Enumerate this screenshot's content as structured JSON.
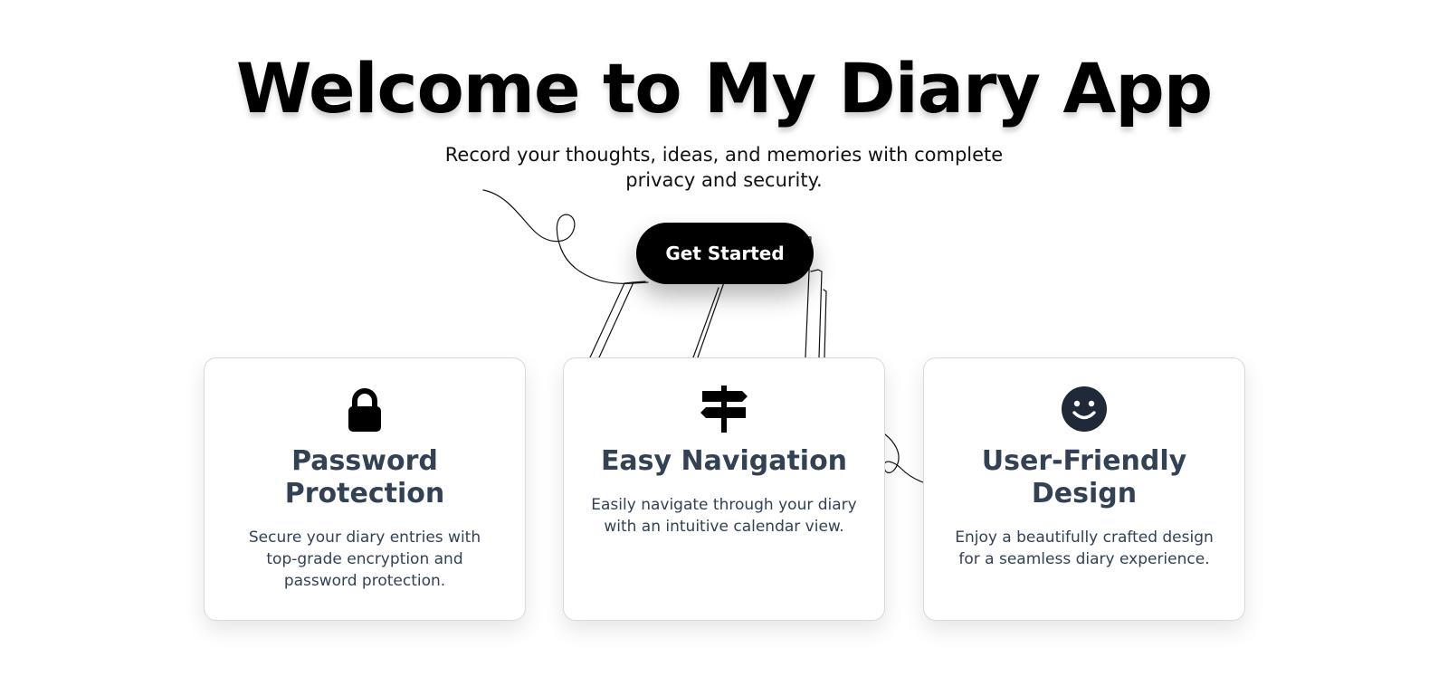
{
  "hero": {
    "title": "Welcome to My Diary App",
    "subtitle": "Record your thoughts, ideas, and memories with complete privacy and security.",
    "cta_label": "Get Started"
  },
  "features": [
    {
      "icon": "lock-icon",
      "title": "Password Protection",
      "description": "Secure your diary entries with top-grade encryption and password protection."
    },
    {
      "icon": "signpost-icon",
      "title": "Easy Navigation",
      "description": "Easily navigate through your diary with an intuitive calendar view."
    },
    {
      "icon": "smiley-icon",
      "title": "User-Friendly Design",
      "description": "Enjoy a beautifully crafted design for a seamless diary experience."
    }
  ],
  "colors": {
    "title_text": "#000000",
    "card_heading": "#334155",
    "button_bg": "#000000",
    "button_text": "#ffffff",
    "card_border": "#d6d9de"
  }
}
